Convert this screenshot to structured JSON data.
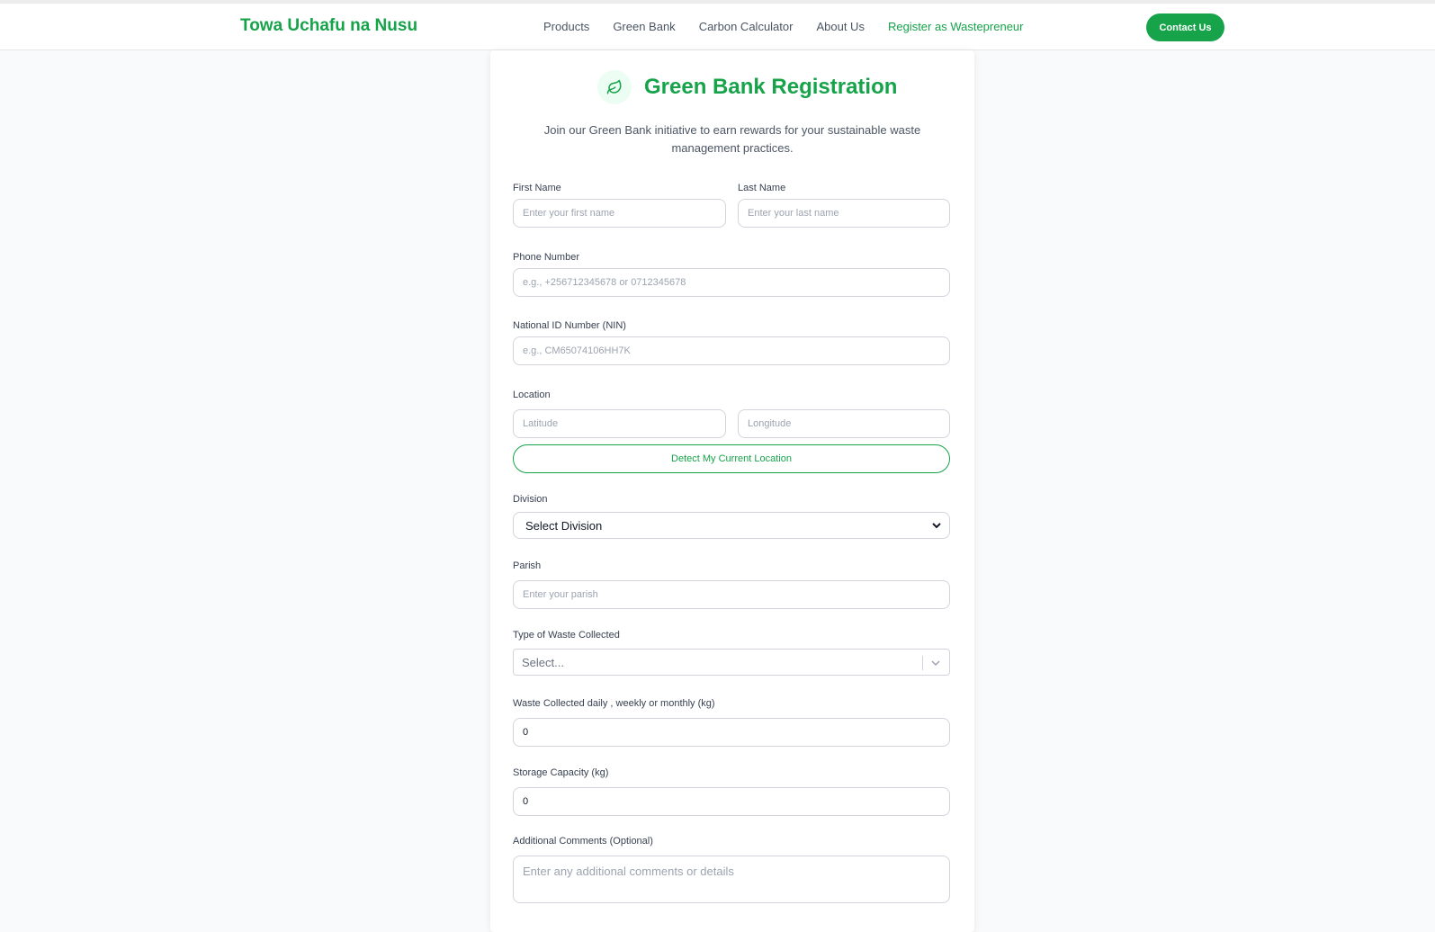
{
  "header": {
    "brand": "Towa Uchafu na Nusu",
    "nav": [
      "Products",
      "Green Bank",
      "Carbon Calculator",
      "About Us",
      "Register as Wastepreneur"
    ],
    "contact_label": "Contact Us"
  },
  "form": {
    "title": "Green Bank Registration",
    "subtitle": "Join our Green Bank initiative to earn rewards for your sustainable waste management practices.",
    "first_name": {
      "label": "First Name",
      "placeholder": "Enter your first name"
    },
    "last_name": {
      "label": "Last Name",
      "placeholder": "Enter your last name"
    },
    "phone": {
      "label": "Phone Number",
      "placeholder": "e.g., +256712345678 or 0712345678"
    },
    "nin": {
      "label": "National ID Number (NIN)",
      "placeholder": "e.g., CM65074106HH7K"
    },
    "location": {
      "label": "Location",
      "lat_placeholder": "Latitude",
      "lng_placeholder": "Longitude",
      "detect_label": "Detect My Current Location"
    },
    "division": {
      "label": "Division",
      "selected": "Select Division"
    },
    "parish": {
      "label": "Parish",
      "placeholder": "Enter your parish"
    },
    "waste_type": {
      "label": "Type of Waste Collected",
      "placeholder": "Select..."
    },
    "waste_collected": {
      "label": "Waste Collected daily , weekly or monthly (kg)",
      "value": "0"
    },
    "storage": {
      "label": "Storage Capacity (kg)",
      "value": "0"
    },
    "comments": {
      "label": "Additional Comments (Optional)",
      "placeholder": "Enter any additional comments or details"
    }
  },
  "colors": {
    "accent": "#16a34a",
    "border": "#d1d5db",
    "background": "#f9fafb"
  },
  "icons": {
    "title_icon": "leaf-icon",
    "select_icon": "chevron-down-icon"
  }
}
